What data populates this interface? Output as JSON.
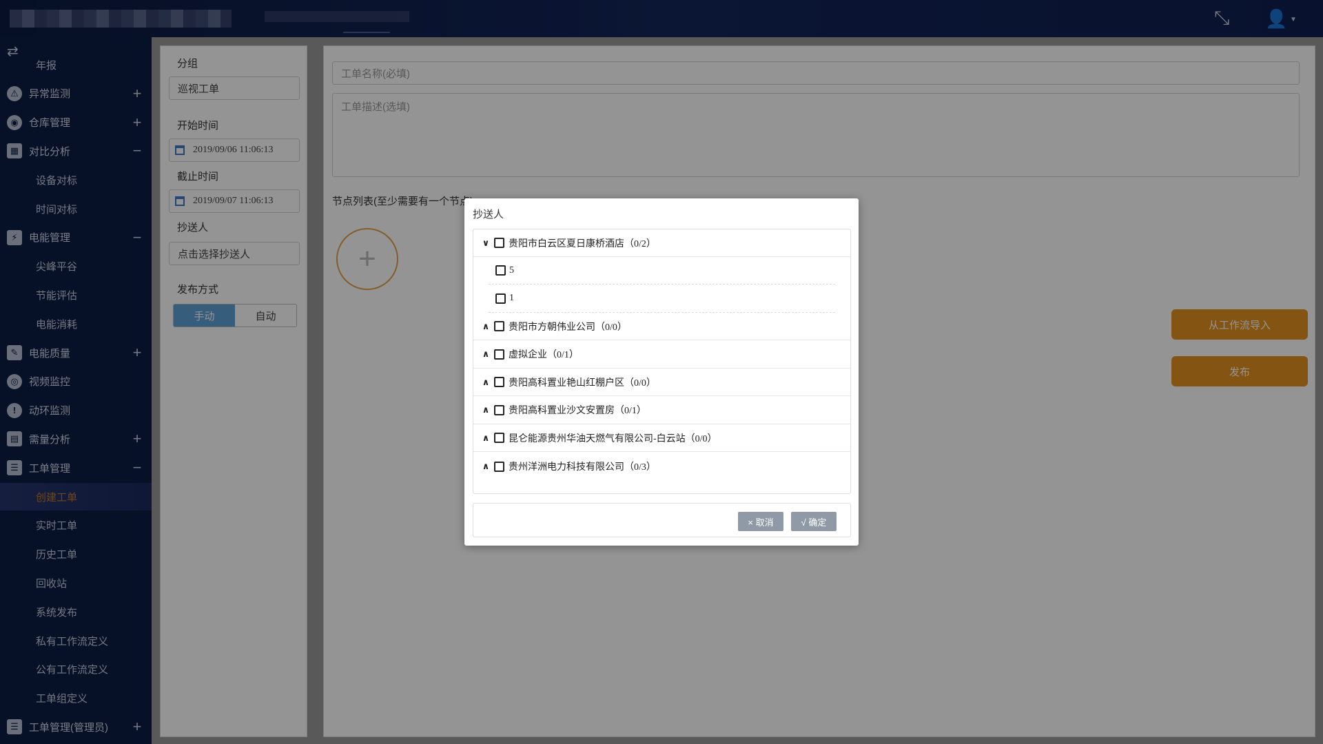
{
  "header": {
    "compress_icon": "compress-icon",
    "user_icon": "user-icon"
  },
  "sidebar": {
    "toggle_icon": "swap-icon",
    "items": [
      {
        "label": "年报",
        "type": "sub"
      },
      {
        "label": "异常监测",
        "type": "group",
        "toggle": "+",
        "icon": "⚠"
      },
      {
        "label": "仓库管理",
        "type": "group",
        "toggle": "+",
        "icon": "◉"
      },
      {
        "label": "对比分析",
        "type": "group",
        "toggle": "−",
        "icon": "▦"
      },
      {
        "label": "设备对标",
        "type": "sub"
      },
      {
        "label": "时间对标",
        "type": "sub"
      },
      {
        "label": "电能管理",
        "type": "group",
        "toggle": "−",
        "icon": "⚡"
      },
      {
        "label": "尖峰平谷",
        "type": "sub"
      },
      {
        "label": "节能评估",
        "type": "sub"
      },
      {
        "label": "电能消耗",
        "type": "sub"
      },
      {
        "label": "电能质量",
        "type": "group",
        "toggle": "+",
        "icon": "✎"
      },
      {
        "label": "视频监控",
        "type": "group",
        "toggle": "",
        "icon": "◎"
      },
      {
        "label": "动环监测",
        "type": "group",
        "toggle": "",
        "icon": "!"
      },
      {
        "label": "需量分析",
        "type": "group",
        "toggle": "+",
        "icon": "▤"
      },
      {
        "label": "工单管理",
        "type": "group",
        "toggle": "−",
        "icon": "☰"
      },
      {
        "label": "创建工单",
        "type": "sub",
        "active": true
      },
      {
        "label": "实时工单",
        "type": "sub"
      },
      {
        "label": "历史工单",
        "type": "sub"
      },
      {
        "label": "回收站",
        "type": "sub"
      },
      {
        "label": "系统发布",
        "type": "sub"
      },
      {
        "label": "私有工作流定义",
        "type": "sub"
      },
      {
        "label": "公有工作流定义",
        "type": "sub"
      },
      {
        "label": "工单组定义",
        "type": "sub"
      },
      {
        "label": "工单管理(管理员)",
        "type": "group",
        "toggle": "+",
        "icon": "☰"
      }
    ]
  },
  "form": {
    "group_label": "分组",
    "group_value": "巡视工单",
    "start_label": "开始时间",
    "start_value": "2019/09/06 11:06:13",
    "end_label": "截止时间",
    "end_value": "2019/09/07 11:06:13",
    "cc_label": "抄送人",
    "cc_value": "点击选择抄送人",
    "publish_label": "发布方式",
    "publish_manual": "手动",
    "publish_auto": "自动"
  },
  "main": {
    "name_placeholder": "工单名称(必填)",
    "desc_placeholder": "工单描述(选填)",
    "node_list_label": "节点列表(至少需要有一个节点)",
    "add_symbol": "+",
    "import_button": "从工作流导入",
    "publish_button": "发布"
  },
  "modal": {
    "title": "抄送人",
    "tree": [
      {
        "label": "贵阳市白云区夏日康桥酒店",
        "count": "（0/2）",
        "expanded": true,
        "children": [
          {
            "label": "5"
          },
          {
            "label": "1"
          }
        ]
      },
      {
        "label": "贵阳市方朝伟业公司",
        "count": "（0/0）",
        "expanded": false
      },
      {
        "label": "虚拟企业",
        "count": "（0/1）",
        "expanded": false
      },
      {
        "label": "贵阳高科置业艳山红棚户区",
        "count": "（0/0）",
        "expanded": false
      },
      {
        "label": "贵阳高科置业沙文安置房",
        "count": "（0/1）",
        "expanded": false
      },
      {
        "label": "昆仑能源贵州华油天燃气有限公司-白云站",
        "count": "（0/0）",
        "expanded": false
      },
      {
        "label": "贵州洋洲电力科技有限公司",
        "count": "（0/3）",
        "expanded": false
      }
    ],
    "cancel_button": "× 取消",
    "ok_button": "√ 确定"
  }
}
